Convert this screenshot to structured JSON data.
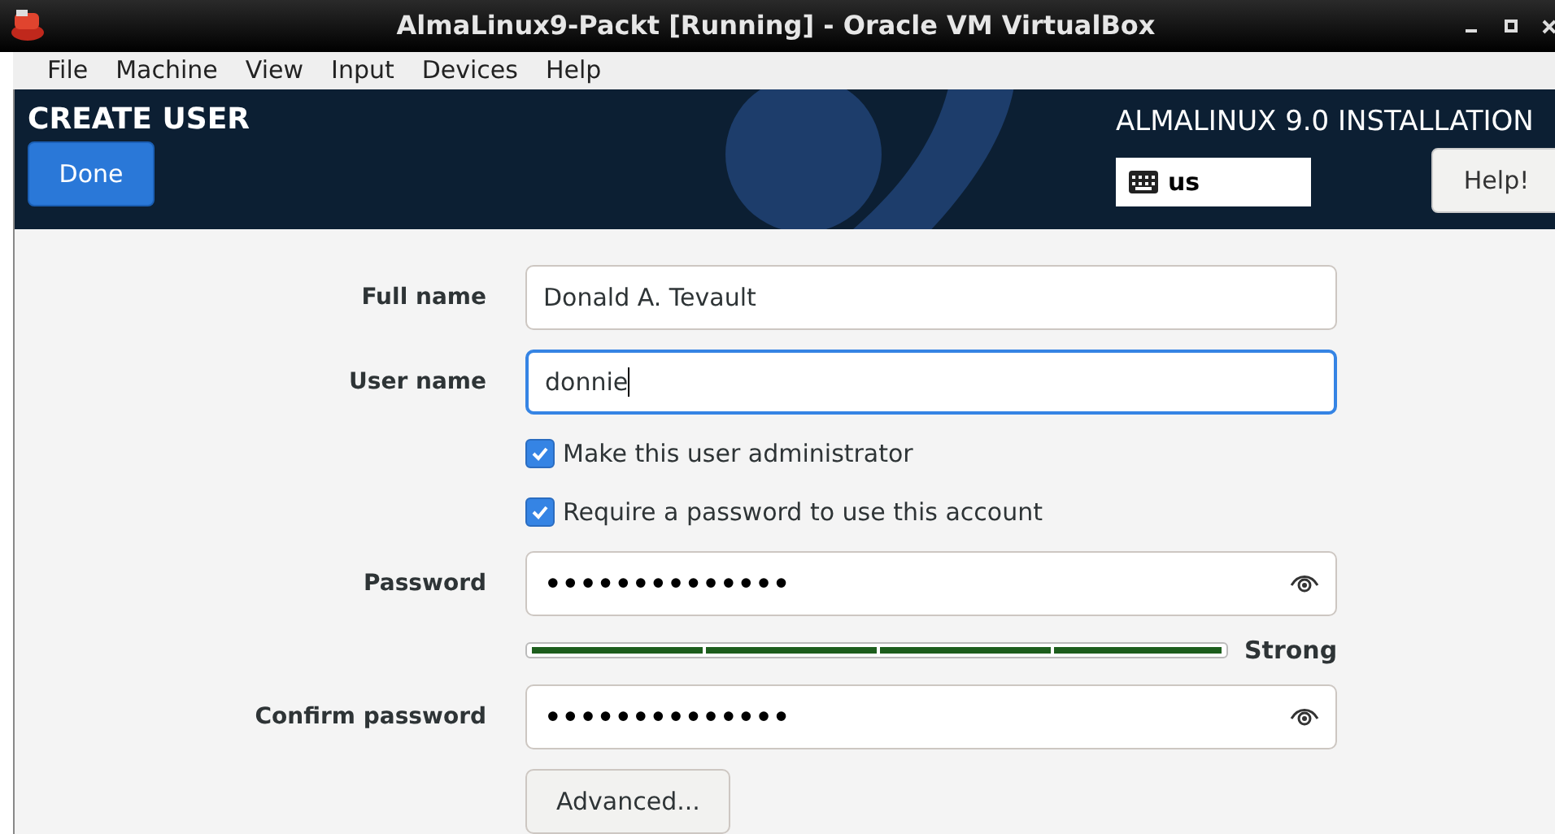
{
  "window": {
    "title": "AlmaLinux9-Packt [Running] - Oracle VM VirtualBox"
  },
  "menu": [
    "File",
    "Machine",
    "View",
    "Input",
    "Devices",
    "Help"
  ],
  "header": {
    "title": "CREATE USER",
    "done_button": "Done",
    "product": "ALMALINUX 9.0 INSTALLATION",
    "keyboard_layout": "us",
    "help_button": "Help!"
  },
  "form": {
    "fields": [
      {
        "kind": "text",
        "label": "Full name",
        "value": "Donald A. Tevault",
        "focused": false
      },
      {
        "kind": "text",
        "label": "User name",
        "value": "donnie",
        "focused": true
      },
      {
        "kind": "checkbox",
        "label": "Make this user administrator",
        "checked": true
      },
      {
        "kind": "checkbox",
        "label": "Require a password to use this account",
        "checked": true
      },
      {
        "kind": "password",
        "label": "Password",
        "value": "••••••••••••••",
        "focused": false
      },
      {
        "kind": "strength",
        "level": 1,
        "reading": "Strong"
      },
      {
        "kind": "password",
        "label": "Confirm password",
        "value": "••••••••••••••",
        "focused": false
      }
    ],
    "advanced_button": "Advanced..."
  }
}
